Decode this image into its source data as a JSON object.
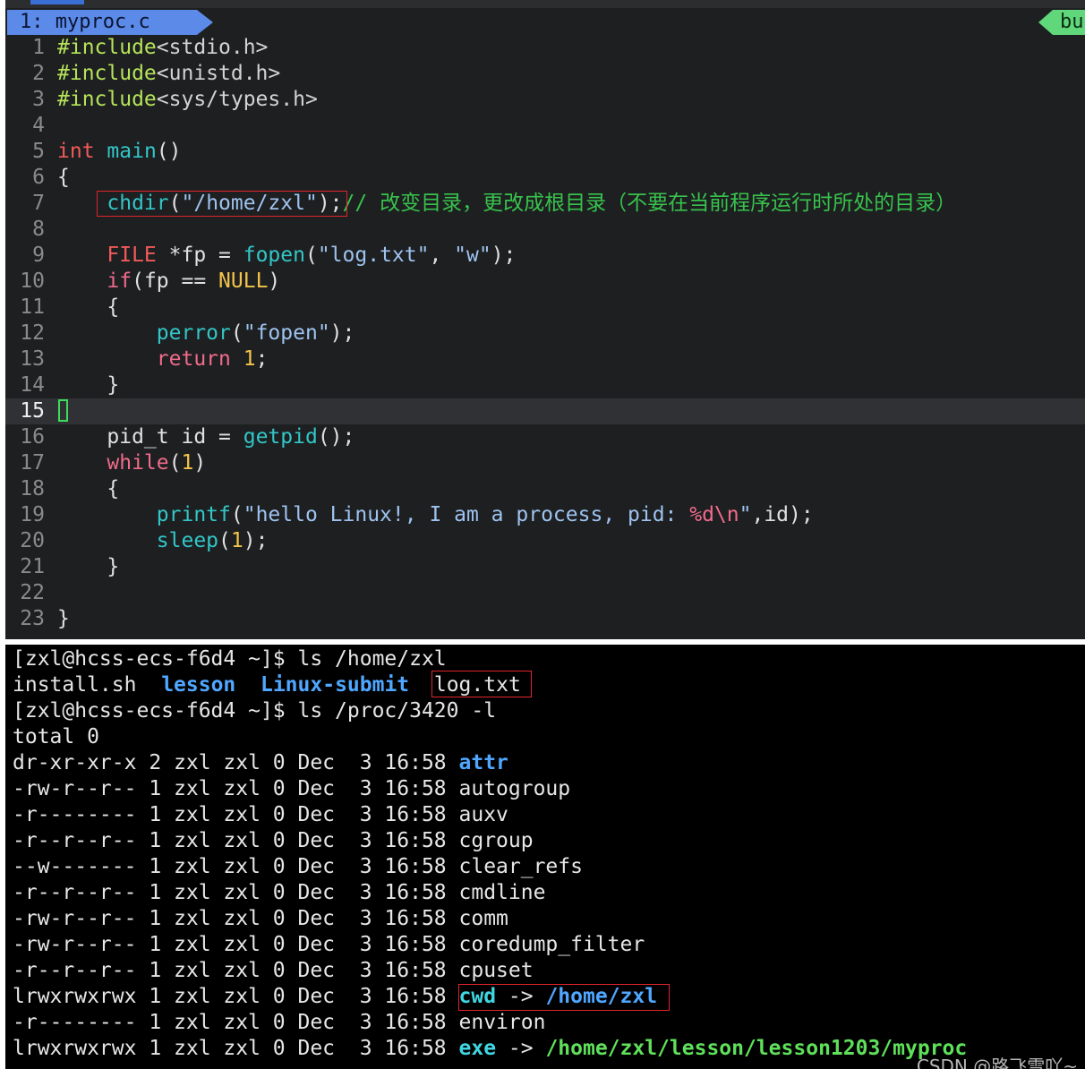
{
  "editor": {
    "tab_active": "1: myproc.c",
    "tab_right": "bu",
    "lines": [
      {
        "n": "1"
      },
      {
        "n": "2"
      },
      {
        "n": "3"
      },
      {
        "n": "4"
      },
      {
        "n": "5"
      },
      {
        "n": "6"
      },
      {
        "n": "7"
      },
      {
        "n": "8"
      },
      {
        "n": "9"
      },
      {
        "n": "10"
      },
      {
        "n": "11"
      },
      {
        "n": "12"
      },
      {
        "n": "13"
      },
      {
        "n": "14"
      },
      {
        "n": "15"
      },
      {
        "n": "16"
      },
      {
        "n": "17"
      },
      {
        "n": "18"
      },
      {
        "n": "19"
      },
      {
        "n": "20"
      },
      {
        "n": "21"
      },
      {
        "n": "22"
      },
      {
        "n": "23"
      }
    ],
    "code": {
      "l1_pre": "#include",
      "l1_head": "<stdio.h>",
      "l2_pre": "#include",
      "l2_head": "<unistd.h>",
      "l3_pre": "#include",
      "l3_head": "<sys/types.h>",
      "l5_type": "int",
      "l5_func": "main",
      "l5_rest": "()",
      "l6": "{",
      "l7_indent": "    ",
      "l7_func": "chdir",
      "l7_open": "(",
      "l7_str": "\"/home/zxl\"",
      "l7_close": ");",
      "l7_comment": "// 改变目录，更改成根目录（不要在当前程序运行时所处的目录）",
      "l9_indent": "    ",
      "l9_type": "FILE",
      "l9_mid": " *fp = ",
      "l9_func": "fopen",
      "l9_open": "(",
      "l9_str1": "\"log.txt\"",
      "l9_comma": ", ",
      "l9_str2": "\"w\"",
      "l9_close": ");",
      "l10_indent": "    ",
      "l10_kw": "if",
      "l10_mid": "(fp == ",
      "l10_null": "NULL",
      "l10_close": ")",
      "l11": "    {",
      "l12_indent": "        ",
      "l12_func": "perror",
      "l12_open": "(",
      "l12_str": "\"fopen\"",
      "l12_close": ");",
      "l13_indent": "        ",
      "l13_kw": "return",
      "l13_sp": " ",
      "l13_num": "1",
      "l13_close": ";",
      "l14": "    }",
      "l16_indent": "    ",
      "l16_mid": "pid_t id = ",
      "l16_func": "getpid",
      "l16_close": "();",
      "l17_indent": "    ",
      "l17_kw": "while",
      "l17_open": "(",
      "l17_num": "1",
      "l17_close": ")",
      "l18": "    {",
      "l19_indent": "        ",
      "l19_func": "printf",
      "l19_open": "(",
      "l19_str": "\"hello Linux!, I am a process, pid: ",
      "l19_fmt": "%d\\n",
      "l19_strend": "\"",
      "l19_close": ",id);",
      "l20_indent": "        ",
      "l20_func": "sleep",
      "l20_open": "(",
      "l20_num": "1",
      "l20_close": ");",
      "l21": "    }",
      "l23": "}"
    }
  },
  "terminal": {
    "prompt1": "[zxl@hcss-ecs-f6d4 ~]$ ls /home/zxl",
    "ls_file1": "install.sh",
    "ls_dir1": "lesson",
    "ls_dir2": "Linux-submit",
    "ls_file2": "log.txt",
    "prompt2": "[zxl@hcss-ecs-f6d4 ~]$ ls /proc/3420 -l",
    "total": "total 0",
    "entries": [
      {
        "meta": "dr-xr-xr-x 2 zxl zxl 0 Dec  3 16:58 ",
        "name": "attr"
      },
      {
        "meta": "-rw-r--r-- 1 zxl zxl 0 Dec  3 16:58 ",
        "name": "autogroup"
      },
      {
        "meta": "-r-------- 1 zxl zxl 0 Dec  3 16:58 ",
        "name": "auxv"
      },
      {
        "meta": "-r--r--r-- 1 zxl zxl 0 Dec  3 16:58 ",
        "name": "cgroup"
      },
      {
        "meta": "--w------- 1 zxl zxl 0 Dec  3 16:58 ",
        "name": "clear_refs"
      },
      {
        "meta": "-r--r--r-- 1 zxl zxl 0 Dec  3 16:58 ",
        "name": "cmdline"
      },
      {
        "meta": "-rw-r--r-- 1 zxl zxl 0 Dec  3 16:58 ",
        "name": "comm"
      },
      {
        "meta": "-rw-r--r-- 1 zxl zxl 0 Dec  3 16:58 ",
        "name": "coredump_filter"
      },
      {
        "meta": "-r--r--r-- 1 zxl zxl 0 Dec  3 16:58 ",
        "name": "cpuset"
      },
      {
        "meta": "lrwxrwxrwx 1 zxl zxl 0 Dec  3 16:58 ",
        "name": "cwd",
        "arrow": " -> ",
        "target": "/home/zxl"
      },
      {
        "meta": "-r-------- 1 zxl zxl 0 Dec  3 16:58 ",
        "name": "environ"
      },
      {
        "meta": "lrwxrwxrwx 1 zxl zxl 0 Dec  3 16:58 ",
        "name": "exe",
        "arrow": " -> ",
        "target": "/home/zxl/lesson/lesson1203/myproc"
      }
    ]
  },
  "watermark": "CSDN @路飞雪吖~"
}
